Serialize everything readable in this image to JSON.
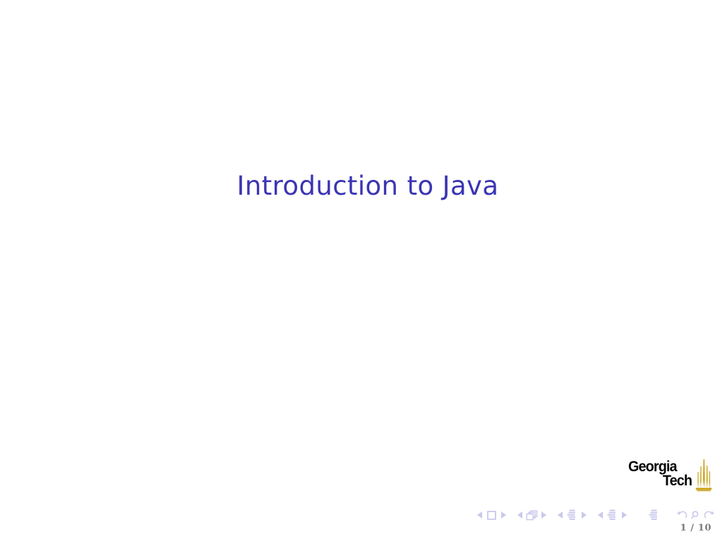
{
  "slide": {
    "title": "Introduction to Java",
    "background_color": "#ffffff",
    "title_color": "#3b35b3"
  },
  "logo": {
    "name": "georgia-tech-logo",
    "line1": "Georgia",
    "line2": "Tech",
    "text_color": "#050505",
    "flame_color": "#c8a117",
    "flame_icon": "gt-flame-icon"
  },
  "navigation": {
    "icon_color": "#c9c9ec",
    "groups": [
      {
        "name": "slide-navigation",
        "prev_icon": "triangle-left-icon",
        "symbol_icon": "square-icon",
        "next_icon": "triangle-right-icon"
      },
      {
        "name": "frame-navigation",
        "prev_icon": "triangle-left-icon",
        "symbol_icon": "stacked-pages-icon",
        "next_icon": "triangle-right-icon"
      },
      {
        "name": "subsection-navigation",
        "prev_icon": "triangle-left-icon",
        "symbol_icon": "list-lines-icon",
        "next_icon": "triangle-right-icon"
      },
      {
        "name": "section-navigation",
        "prev_icon": "triangle-left-icon",
        "symbol_icon": "list-lines-icon",
        "next_icon": "triangle-right-icon"
      }
    ],
    "presentation_icon": "list-lines-icon",
    "back_icon": "arrow-back-icon",
    "search_icon": "magnifier-icon",
    "forward_icon": "arrow-forward-icon"
  },
  "footer": {
    "page_indicator": "1 / 10",
    "page_indicator_color": "#7b7b7b"
  }
}
